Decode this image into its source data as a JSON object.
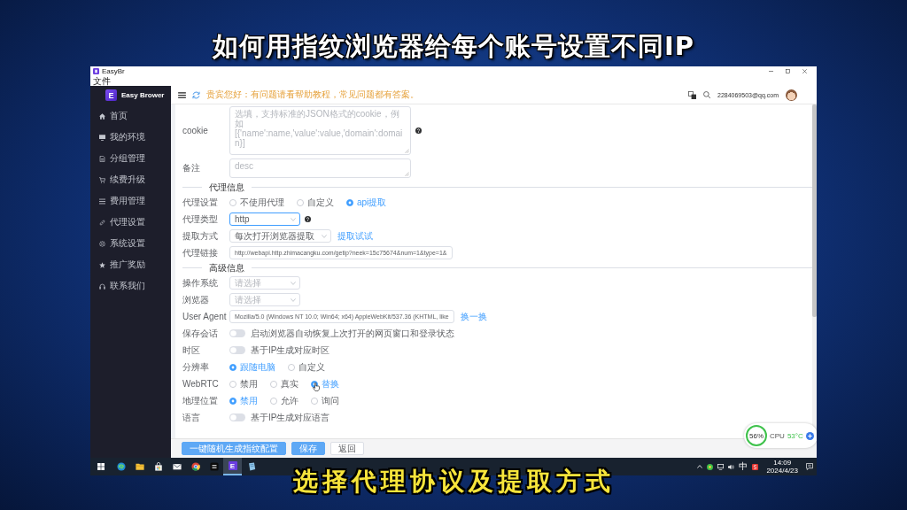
{
  "video_caption": {
    "title": "如何用指纹浏览器给每个账号设置不同IP",
    "subtitle": "选择代理协议及提取方式"
  },
  "window": {
    "title": "EasyBr",
    "menu": [
      {
        "label": "文件"
      }
    ]
  },
  "header": {
    "logo_letter": "E",
    "app_name": "Easy Brower",
    "notice": "贵宾您好：有问题请看帮助教程，常见问题都有答案。",
    "user_email": "2284069503@qq.com"
  },
  "sidebar": {
    "items": [
      {
        "label": "首页",
        "selected": false
      },
      {
        "label": "我的环境",
        "selected": false
      },
      {
        "label": "分组管理",
        "selected": false
      },
      {
        "label": "续费升级",
        "selected": false
      },
      {
        "label": "费用管理",
        "selected": false
      },
      {
        "label": "代理设置",
        "selected": false
      },
      {
        "label": "系统设置",
        "selected": false
      },
      {
        "label": "推广奖励",
        "selected": false
      },
      {
        "label": "联系我们",
        "selected": false
      }
    ]
  },
  "form": {
    "rows": [
      {
        "kind": "textarea",
        "label": "cookie",
        "placeholder": "选填，支持标准的JSON格式的cookie，例如[{'name':name,'value':value,'domain':domain}]",
        "help": true
      },
      {
        "kind": "textarea",
        "label": "备注",
        "placeholder": "desc"
      },
      {
        "kind": "divider",
        "label": "代理信息"
      },
      {
        "kind": "radio",
        "label": "代理设置",
        "options": [
          {
            "label": "不使用代理",
            "selected": false
          },
          {
            "label": "自定义",
            "selected": false
          },
          {
            "label": "api提取",
            "selected": true
          }
        ]
      },
      {
        "kind": "select",
        "label": "代理类型",
        "value": "http",
        "focused": true,
        "help": true
      },
      {
        "kind": "select",
        "label": "提取方式",
        "value": "每次打开浏览器提取",
        "focused": false,
        "link": "提取试试"
      },
      {
        "kind": "input",
        "label": "代理链接",
        "value": "http://webapi.http.zhimacangku.com/getip?neek=15c75674&num=1&type=1&"
      },
      {
        "kind": "divider",
        "label": "高级信息"
      },
      {
        "kind": "select",
        "label": "操作系统",
        "placeholder": "请选择",
        "focused": false
      },
      {
        "kind": "select",
        "label": "浏览器",
        "placeholder": "请选择",
        "focused": false
      },
      {
        "kind": "input",
        "label": "User Agent",
        "value": "Mozilla/5.0 (Windows NT 10.0; Win64; x64) AppleWebKit/537.36 (KHTML, like",
        "link": "换一换"
      },
      {
        "kind": "toggle",
        "label": "保存会话",
        "on": false,
        "text": "启动浏览器自动恢复上次打开的网页窗口和登录状态"
      },
      {
        "kind": "toggle",
        "label": "时区",
        "on": false,
        "text": "基于IP生成对应时区"
      },
      {
        "kind": "radio",
        "label": "分辨率",
        "options": [
          {
            "label": "跟随电脑",
            "selected": true
          },
          {
            "label": "自定义",
            "selected": false
          }
        ]
      },
      {
        "kind": "radio",
        "label": "WebRTC",
        "options": [
          {
            "label": "禁用",
            "selected": false
          },
          {
            "label": "真实",
            "selected": false
          },
          {
            "label": "替换",
            "selected": true,
            "hovered": true
          }
        ]
      },
      {
        "kind": "radio",
        "label": "地理位置",
        "options": [
          {
            "label": "禁用",
            "selected": true
          },
          {
            "label": "允许",
            "selected": false
          },
          {
            "label": "询问",
            "selected": false
          }
        ]
      },
      {
        "kind": "toggle",
        "label": "语言",
        "on": false,
        "text": "基于IP生成对应语言"
      }
    ]
  },
  "footer": {
    "buttons": [
      {
        "label": "一键随机生成指纹配置",
        "kind": "primary"
      },
      {
        "label": "保存",
        "kind": "primary"
      },
      {
        "label": "返回",
        "kind": "plain"
      }
    ]
  },
  "monitor": {
    "percent": "56%",
    "cpu_label": "CPU",
    "cpu_temp": "53°C"
  },
  "taskbar": {
    "apps": [
      {
        "selected": false
      },
      {
        "selected": false
      },
      {
        "selected": false
      },
      {
        "selected": false
      },
      {
        "selected": false
      },
      {
        "selected": false
      },
      {
        "selected": true,
        "letter": "E"
      },
      {
        "selected": false
      }
    ],
    "ime": "中",
    "time": "14:09",
    "date": "2024/4/23"
  }
}
